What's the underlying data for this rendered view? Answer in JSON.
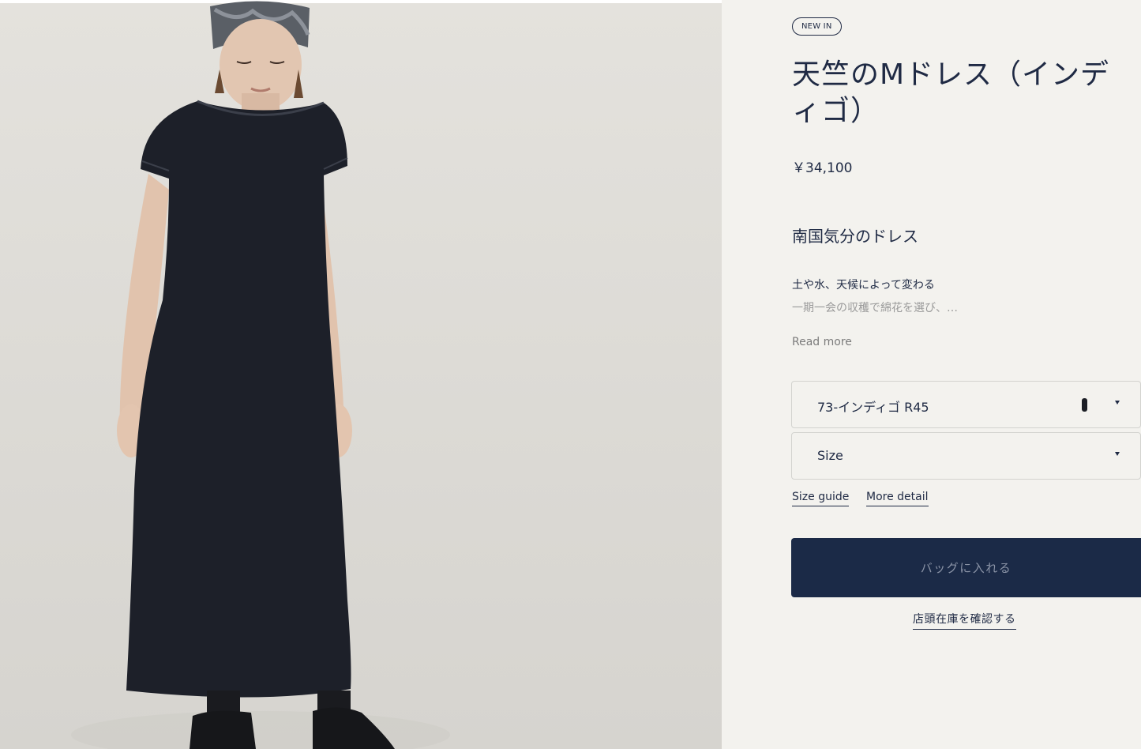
{
  "product": {
    "badge": "NEW IN",
    "title": "天竺のMドレス（インディゴ）",
    "price": "￥34,100",
    "subtitle": "南国気分のドレス",
    "description_line1": "土や水、天候によって変わる",
    "description_line2": "一期一会の収穫で綿花を選び、…",
    "read_more": "Read more"
  },
  "options": {
    "color": {
      "value": "73-インディゴ R45",
      "swatch_color": "#1b1e25"
    },
    "size": {
      "value": "Size"
    }
  },
  "links": {
    "size_guide": "Size guide",
    "more_detail": "More detail"
  },
  "actions": {
    "add_to_bag": "バッグに入れる",
    "check_store_stock": "店頭在庫を確認する"
  },
  "image": {
    "subject": "model-wearing-indigo-dress"
  },
  "colors": {
    "primary": "#1b2a47",
    "text": "#1f2a44",
    "panel_bg": "#f3f2ee"
  }
}
